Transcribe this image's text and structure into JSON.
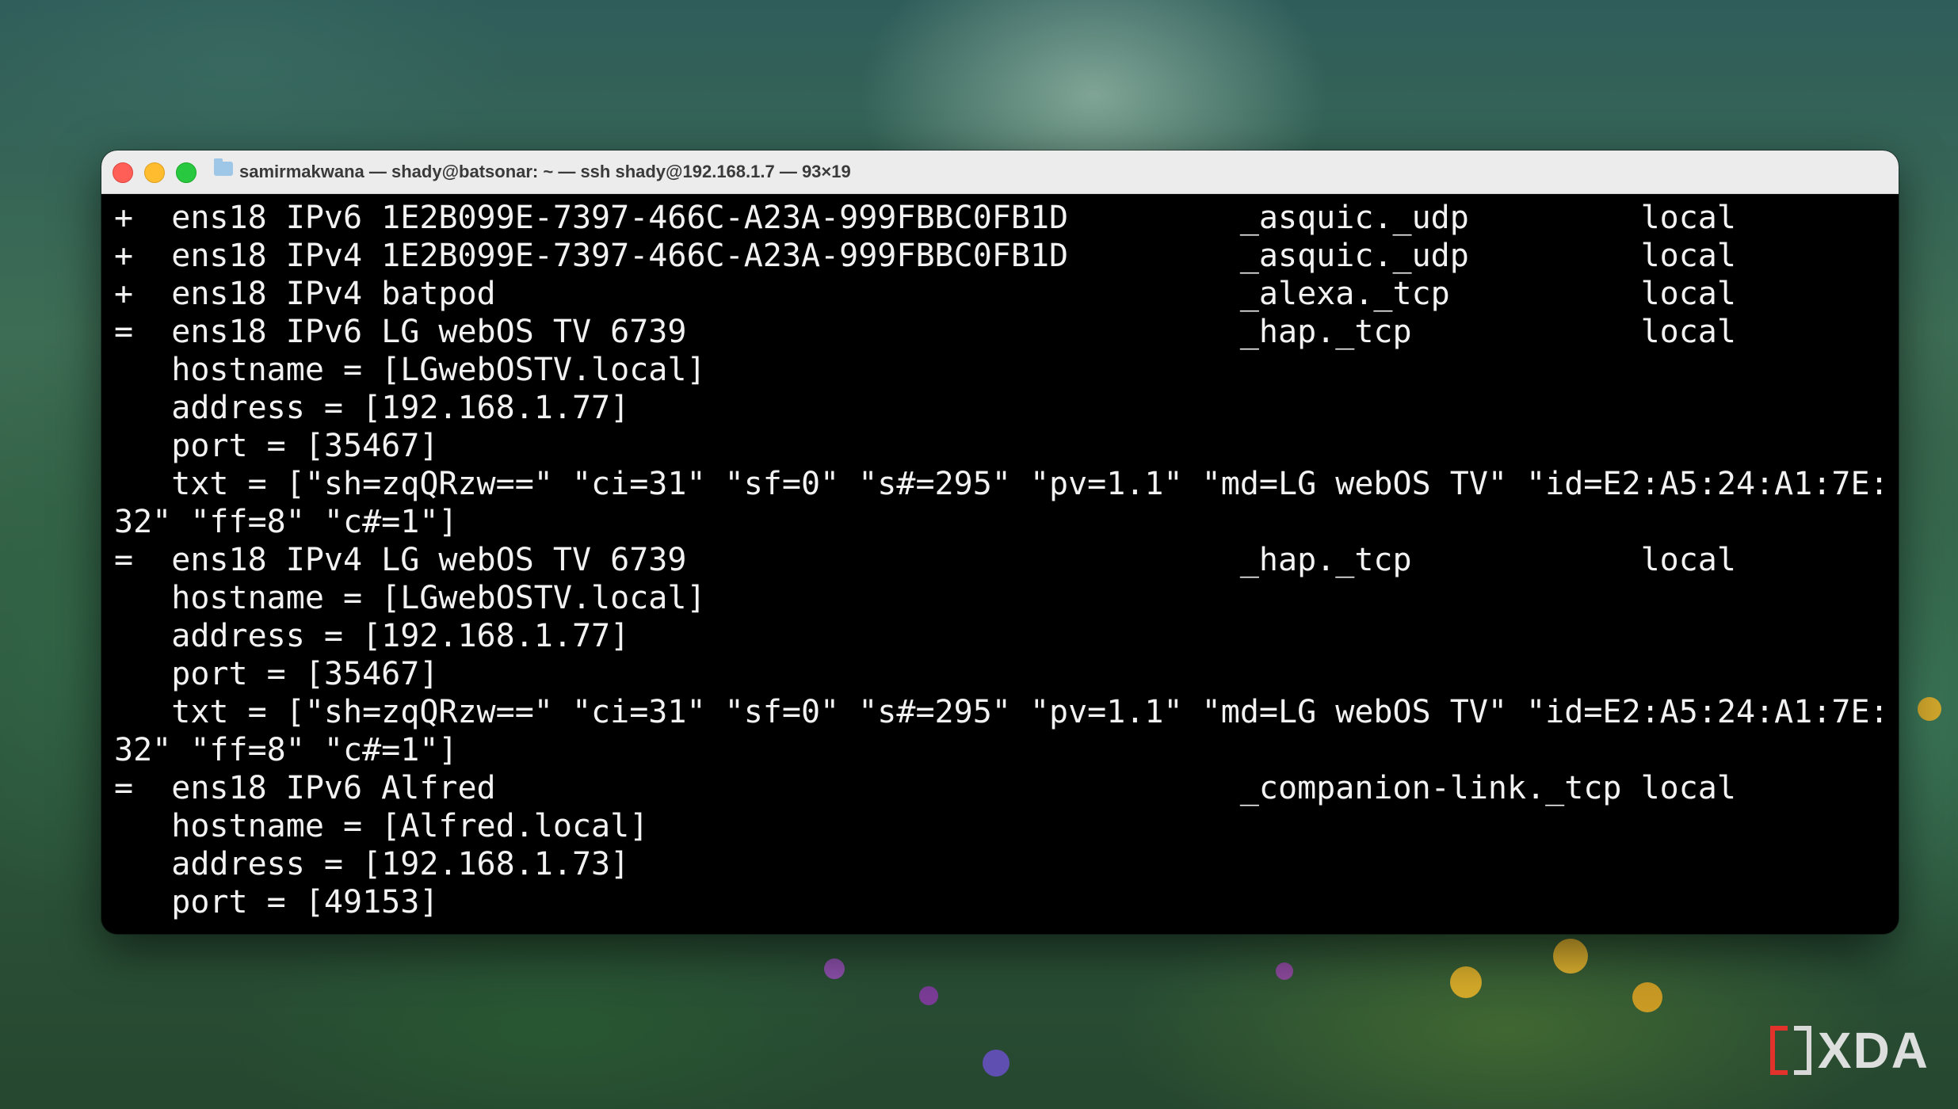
{
  "window": {
    "title": "samirmakwana — shady@batsonar: ~ — ssh shady@192.168.1.7 — 93×19",
    "colors": {
      "close": "#ff5f57",
      "minimize": "#febc2e",
      "maximize": "#28c840",
      "terminal_bg": "#000000",
      "terminal_fg": "#f2f2f2"
    }
  },
  "terminal": {
    "lines": [
      "+  ens18 IPv6 1E2B099E-7397-466C-A23A-999FBBC0FB1D         _asquic._udp         local",
      "+  ens18 IPv4 1E2B099E-7397-466C-A23A-999FBBC0FB1D         _asquic._udp         local",
      "+  ens18 IPv4 batpod                                       _alexa._tcp          local",
      "=  ens18 IPv6 LG webOS TV 6739                             _hap._tcp            local",
      "   hostname = [LGwebOSTV.local]",
      "   address = [192.168.1.77]",
      "   port = [35467]",
      "   txt = [\"sh=zqQRzw==\" \"ci=31\" \"sf=0\" \"s#=295\" \"pv=1.1\" \"md=LG webOS TV\" \"id=E2:A5:24:A1:7E:",
      "32\" \"ff=8\" \"c#=1\"]",
      "=  ens18 IPv4 LG webOS TV 6739                             _hap._tcp            local",
      "   hostname = [LGwebOSTV.local]",
      "   address = [192.168.1.77]",
      "   port = [35467]",
      "   txt = [\"sh=zqQRzw==\" \"ci=31\" \"sf=0\" \"s#=295\" \"pv=1.1\" \"md=LG webOS TV\" \"id=E2:A5:24:A1:7E:",
      "32\" \"ff=8\" \"c#=1\"]",
      "=  ens18 IPv6 Alfred                                       _companion-link._tcp local",
      "   hostname = [Alfred.local]",
      "   address = [192.168.1.73]",
      "   port = [49153]"
    ]
  },
  "watermark": {
    "text": "XDA"
  }
}
